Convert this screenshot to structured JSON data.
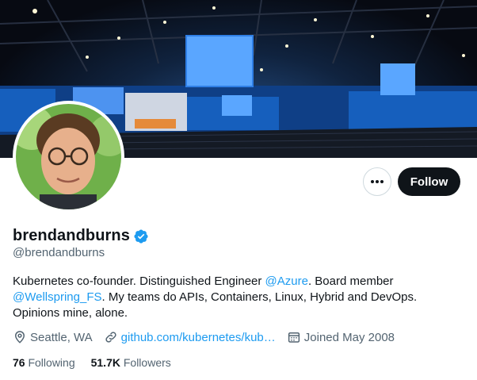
{
  "profile": {
    "display_name": "brendandburns",
    "handle": "@brendandburns",
    "verified": true,
    "bio": {
      "part1": "Kubernetes co-founder. Distinguished Engineer ",
      "mention1": "@Azure",
      "part2": ". Board member ",
      "mention2": "@Wellspring_FS",
      "part3": ". My teams do APIs, Containers, Linux, Hybrid and DevOps. Opinions mine, alone."
    },
    "location": "Seattle, WA",
    "website": "github.com/kubernetes/kub…",
    "joined": "Joined May 2008"
  },
  "actions": {
    "more_icon": "more-dots-icon",
    "follow_label": "Follow"
  },
  "stats": {
    "following_count": "76",
    "following_label": "Following",
    "followers_count": "51.7K",
    "followers_label": "Followers"
  },
  "icons": {
    "location": "location-pin-icon",
    "link": "link-icon",
    "calendar": "calendar-icon",
    "verified": "verified-badge-icon"
  },
  "colors": {
    "accent": "#1d9bf0",
    "text_primary": "#0f1419",
    "text_secondary": "#536471",
    "button_dark": "#0f1419"
  }
}
